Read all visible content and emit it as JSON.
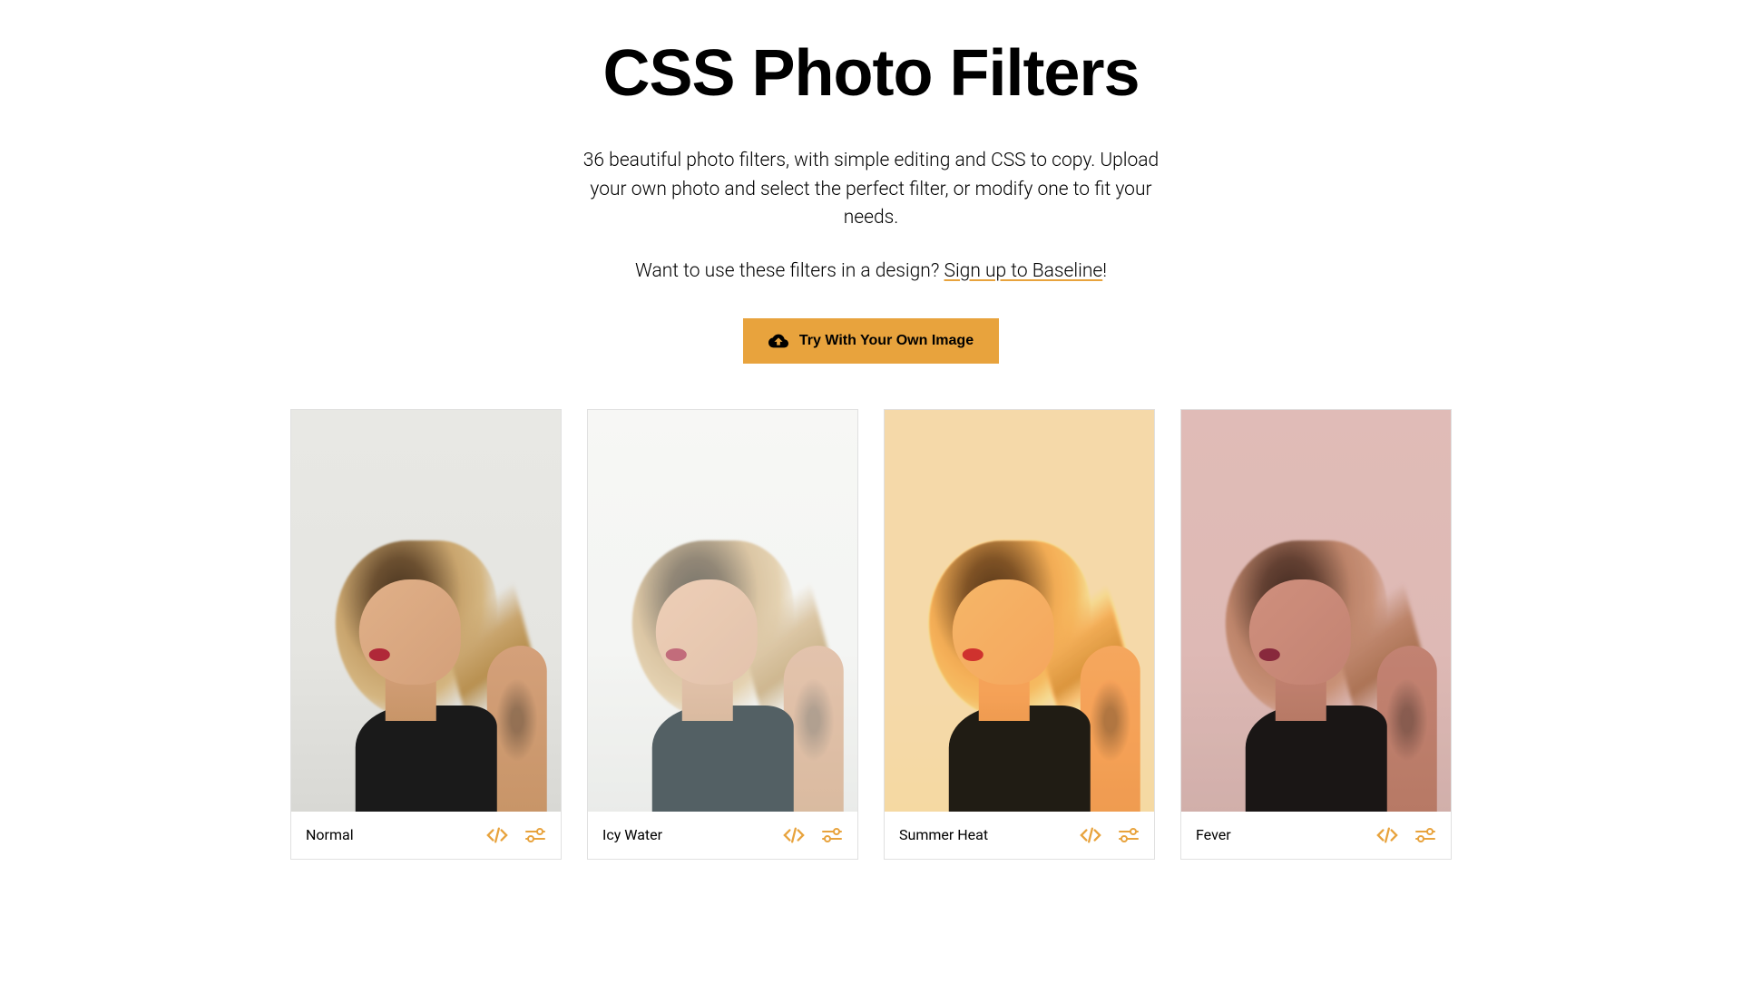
{
  "header": {
    "title": "CSS Photo Filters",
    "description": "36 beautiful photo filters, with simple editing and CSS to copy. Upload your own photo and select the perfect filter, or modify one to fit your needs.",
    "cta_prefix": "Want to use these filters in a design? ",
    "cta_link_text": "Sign up to Baseline",
    "cta_suffix": "!",
    "upload_button_label": "Try With Your Own Image"
  },
  "filters": [
    {
      "name": "Normal",
      "filter_class": "filter-normal"
    },
    {
      "name": "Icy Water",
      "filter_class": "filter-icy-water"
    },
    {
      "name": "Summer Heat",
      "filter_class": "filter-summer-heat"
    },
    {
      "name": "Fever",
      "filter_class": "filter-fever"
    }
  ],
  "colors": {
    "accent": "#e8a33d",
    "text": "#000000",
    "background": "#ffffff"
  },
  "icons": {
    "upload": "cloud-upload-icon",
    "code": "code-icon",
    "adjust": "sliders-icon"
  }
}
